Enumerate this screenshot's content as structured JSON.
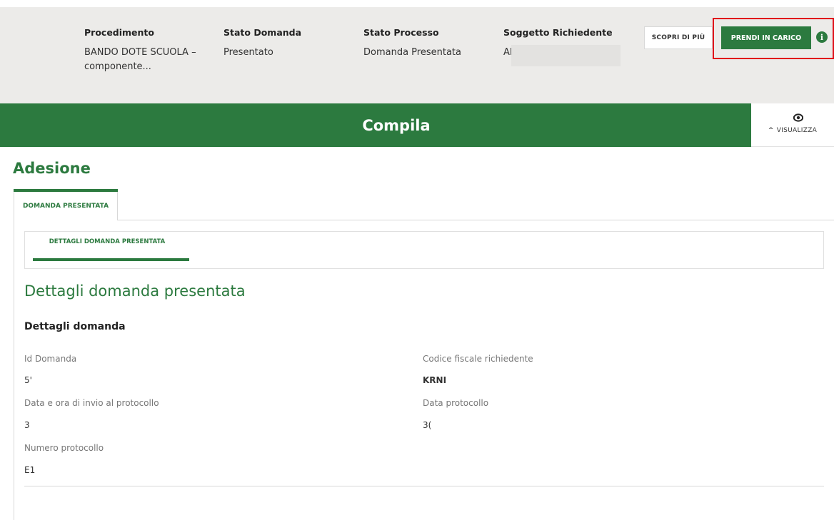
{
  "header": {
    "columns": [
      {
        "label": "Procedimento",
        "value_line1": "BANDO DOTE SCUOLA –",
        "value_line2": "componente..."
      },
      {
        "label": "Stato Domanda",
        "value_line1": "Presentato"
      },
      {
        "label": "Stato Processo",
        "value_line1": "Domanda Presentata"
      },
      {
        "label": "Soggetto Richiedente",
        "value_line1": "Al"
      }
    ],
    "discover_label": "SCOPRI DI PIÙ",
    "take_charge_label": "PRENDI IN CARICO",
    "info_glyph": "i",
    "highlight_color": "#e0101a"
  },
  "compile": {
    "title": "Compila",
    "view_label": "VISUALIZZA",
    "view_glyph": "^"
  },
  "section": {
    "title": "Adesione",
    "tab_label": "DOMANDA PRESENTATA",
    "inner_tab_label": "DETTAGLI DOMANDA PRESENTATA",
    "heading": "Dettagli domanda presentata",
    "subheading": "Dettagli domanda"
  },
  "fields": {
    "id_domanda": {
      "label": "Id Domanda",
      "value": "5'"
    },
    "codice_fiscale": {
      "label": "Codice fiscale richiedente",
      "value": "KRNI"
    },
    "data_invio": {
      "label": "Data e ora di invio al protocollo",
      "value": "3"
    },
    "data_protocollo": {
      "label": "Data protocollo",
      "value": "3("
    },
    "numero_protocollo": {
      "label": "Numero protocollo",
      "value": "E1"
    }
  },
  "colors": {
    "primary_green": "#2c7a3f",
    "header_bg": "#ecebe9"
  },
  "icons": {
    "info": "info-icon",
    "eye": "eye-icon",
    "chevron_up": "chevron-up-icon"
  }
}
